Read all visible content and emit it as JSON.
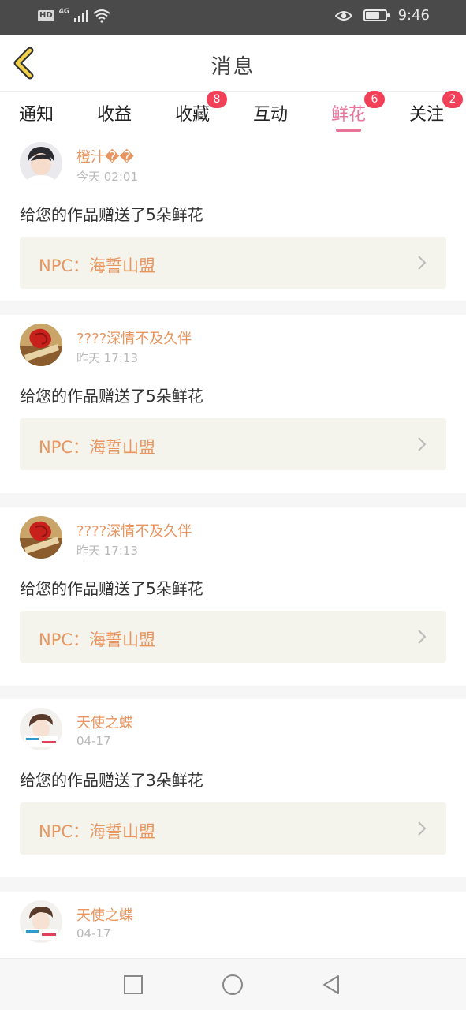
{
  "status_bar": {
    "hd": "HD",
    "network": "4G",
    "time": "9:46",
    "battery_level": 0.7,
    "icons": [
      "signal-icon",
      "wifi-icon",
      "eye-icon",
      "battery-icon"
    ]
  },
  "header": {
    "title": "消息",
    "back_icon": "chevron-left-icon"
  },
  "tabs": [
    {
      "label": "通知",
      "badge": ""
    },
    {
      "label": "收益",
      "badge": ""
    },
    {
      "label": "收藏",
      "badge": "8"
    },
    {
      "label": "互动",
      "badge": ""
    },
    {
      "label": "鲜花",
      "badge": "6",
      "active": true
    },
    {
      "label": "关注",
      "badge": "2"
    }
  ],
  "messages": [
    {
      "name": "橙汁��",
      "time": "今天 02:01",
      "text": "给您的作品赠送了5朵鲜花",
      "work": "NPC：海誓山盟"
    },
    {
      "name": "????深情不及久伴",
      "time": "昨天 17:13",
      "text": "给您的作品赠送了5朵鲜花",
      "work": "NPC：海誓山盟"
    },
    {
      "name": "????深情不及久伴",
      "time": "昨天 17:13",
      "text": "给您的作品赠送了5朵鲜花",
      "work": "NPC：海誓山盟"
    },
    {
      "name": "天使之蝶",
      "time": "04-17",
      "text": "给您的作品赠送了3朵鲜花",
      "work": "NPC：海誓山盟"
    },
    {
      "name": "天使之蝶",
      "time": "04-17",
      "text": "",
      "work": ""
    }
  ],
  "colors": {
    "accent_pink": "#e8749a",
    "name_orange": "#e8955f",
    "badge_red": "#f24058",
    "link_bg": "#f5f4ec",
    "status_bar_bg": "#4a4a4a"
  },
  "system_nav": {
    "icons": [
      "square-recent-icon",
      "circle-home-icon",
      "triangle-back-icon"
    ]
  }
}
